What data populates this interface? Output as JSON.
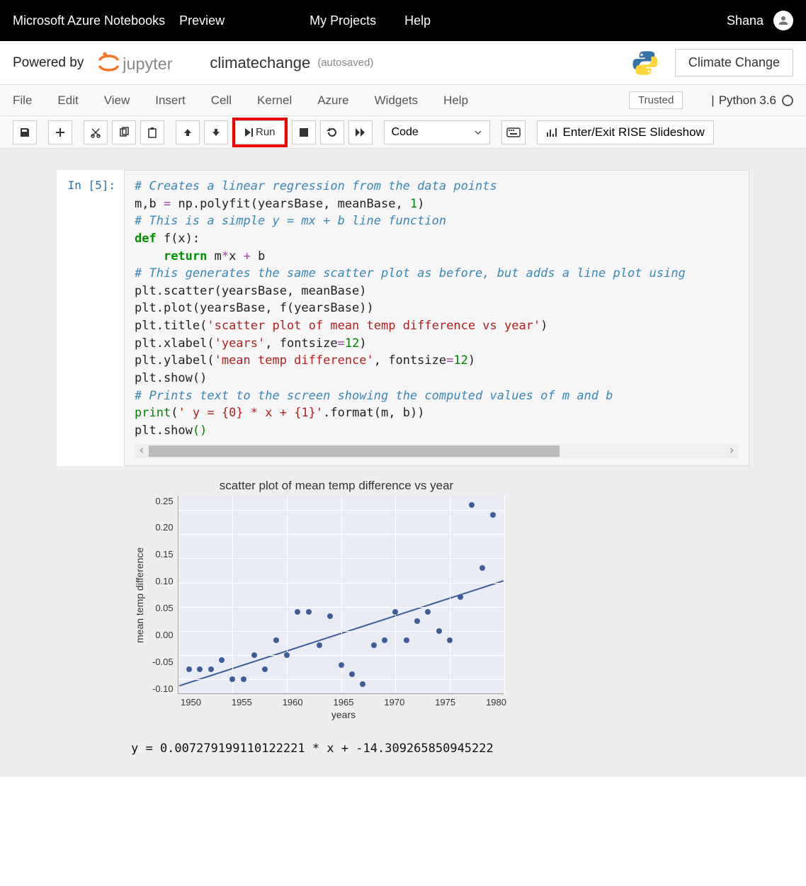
{
  "topbar": {
    "brand": "Microsoft Azure Notebooks",
    "preview": "Preview",
    "my_projects": "My Projects",
    "help": "Help",
    "user": "Shana"
  },
  "subhead": {
    "powered_by": "Powered by",
    "notebook_name": "climatechange",
    "autosaved": "(autosaved)",
    "kernel_button": "Climate Change"
  },
  "menubar": {
    "items": [
      "File",
      "Edit",
      "View",
      "Insert",
      "Cell",
      "Kernel",
      "Azure",
      "Widgets",
      "Help"
    ],
    "trusted": "Trusted",
    "kernel": "Python 3.6"
  },
  "toolbar": {
    "run_label": "Run",
    "celltype": "Code",
    "rise": "Enter/Exit RISE Slideshow"
  },
  "cell": {
    "prompt": "In [5]:",
    "code": {
      "l1": "# Creates a linear regression from the data points",
      "l2a": "m,b ",
      "l2b": "=",
      "l2c": " np.polyfit(yearsBase, meanBase, ",
      "l2d": "1",
      "l2e": ")",
      "l3": "",
      "l4": "# This is a simple y = mx + b line function",
      "l5a": "def",
      "l5b": " f(x):",
      "l6a": "    ",
      "l6b": "return",
      "l6c": " m",
      "l6d": "*",
      "l6e": "x ",
      "l6f": "+",
      "l6g": " b",
      "l7": "",
      "l8": "# This generates the same scatter plot as before, but adds a line plot using",
      "l9": "plt.scatter(yearsBase, meanBase)",
      "l10": "plt.plot(yearsBase, f(yearsBase))",
      "l11a": "plt.title(",
      "l11b": "'scatter plot of mean temp difference vs year'",
      "l11c": ")",
      "l12a": "plt.xlabel(",
      "l12b": "'years'",
      "l12c": ", fontsize",
      "l12d": "=",
      "l12e": "12",
      "l12f": ")",
      "l13a": "plt.ylabel(",
      "l13b": "'mean temp difference'",
      "l13c": ", fontsize",
      "l13d": "=",
      "l13e": "12",
      "l13f": ")",
      "l14": "plt.show()",
      "l15": "",
      "l16": "# Prints text to the screen showing the computed values of m and b",
      "l17a": "print",
      "l17b": "(",
      "l17c": "' y = {0} * x + {1}'",
      "l17d": ".format(m, b))",
      "l18a": "plt.show",
      "l18b": "()"
    }
  },
  "output": {
    "print_line": " y = 0.007279199110122221 * x + -14.309265850945222"
  },
  "chart_data": {
    "type": "scatter_with_line",
    "title": "scatter plot of mean temp difference vs year",
    "xlabel": "years",
    "ylabel": "mean temp difference",
    "xlim": [
      1950,
      1980
    ],
    "ylim": [
      -0.13,
      0.28
    ],
    "yticks": [
      -0.1,
      -0.05,
      0.0,
      0.05,
      0.1,
      0.15,
      0.2,
      0.25
    ],
    "xticks": [
      1950,
      1955,
      1960,
      1965,
      1970,
      1975,
      1980
    ],
    "regression": {
      "m": 0.007279199110122221,
      "b": -14.309265850945222
    },
    "points": [
      {
        "x": 1951,
        "y": -0.08
      },
      {
        "x": 1952,
        "y": -0.08
      },
      {
        "x": 1953,
        "y": -0.08
      },
      {
        "x": 1954,
        "y": -0.06
      },
      {
        "x": 1955,
        "y": -0.1
      },
      {
        "x": 1956,
        "y": -0.1
      },
      {
        "x": 1957,
        "y": -0.05
      },
      {
        "x": 1958,
        "y": -0.08
      },
      {
        "x": 1959,
        "y": -0.02
      },
      {
        "x": 1960,
        "y": -0.05
      },
      {
        "x": 1961,
        "y": 0.04
      },
      {
        "x": 1962,
        "y": 0.04
      },
      {
        "x": 1963,
        "y": -0.03
      },
      {
        "x": 1964,
        "y": 0.03
      },
      {
        "x": 1965,
        "y": -0.07
      },
      {
        "x": 1966,
        "y": -0.09
      },
      {
        "x": 1967,
        "y": -0.11
      },
      {
        "x": 1968,
        "y": -0.03
      },
      {
        "x": 1969,
        "y": -0.02
      },
      {
        "x": 1970,
        "y": 0.04
      },
      {
        "x": 1971,
        "y": -0.02
      },
      {
        "x": 1972,
        "y": 0.02
      },
      {
        "x": 1973,
        "y": 0.04
      },
      {
        "x": 1974,
        "y": 0.0
      },
      {
        "x": 1975,
        "y": -0.02
      },
      {
        "x": 1976,
        "y": 0.07
      },
      {
        "x": 1977,
        "y": 0.26
      },
      {
        "x": 1978,
        "y": 0.13
      },
      {
        "x": 1979,
        "y": 0.24
      }
    ]
  }
}
